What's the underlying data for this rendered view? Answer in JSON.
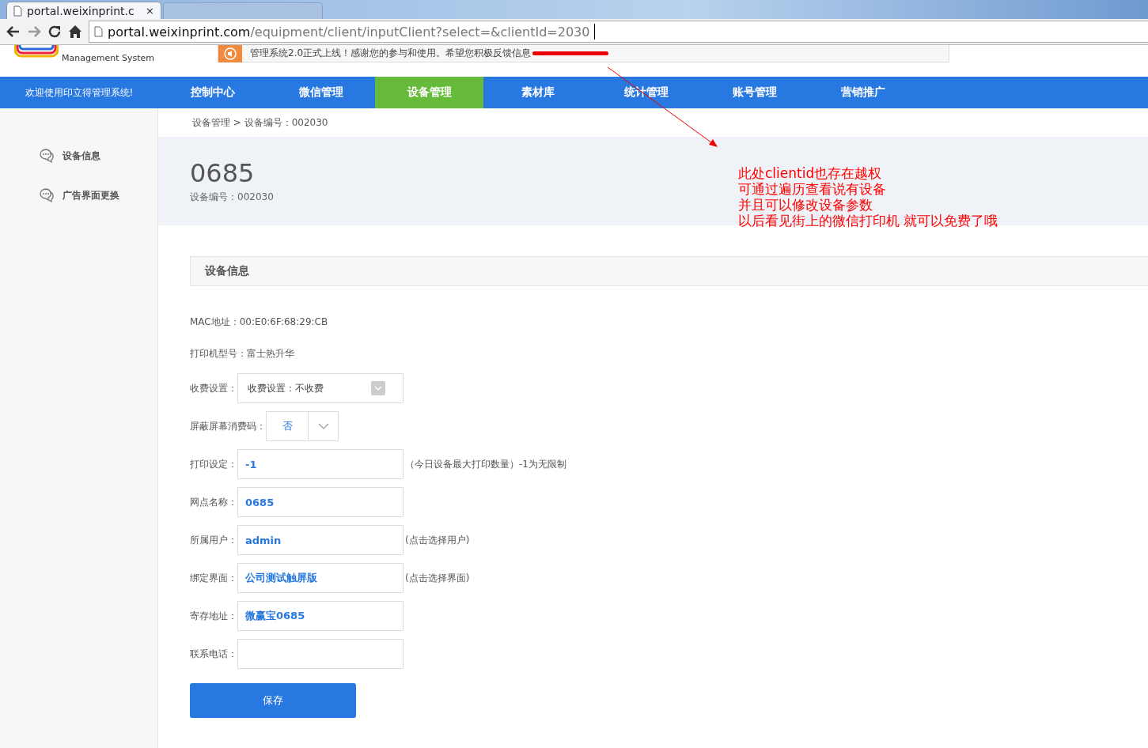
{
  "browser": {
    "tab_title": "portal.weixinprint.c",
    "tab_close": "×",
    "url_host": "portal.weixinprint.com",
    "url_path": "/equipment/client/inputClient?select=&clientId=2030"
  },
  "header": {
    "logo_subtitle": "Management System",
    "notice": "管理系统2.0正式上线！感谢您的参与和使用。希望您积极反馈信息"
  },
  "nav": {
    "welcome": "欢迎使用印立得管理系统!",
    "items": [
      {
        "label": "控制中心",
        "selected": false
      },
      {
        "label": "微信管理",
        "selected": false
      },
      {
        "label": "设备管理",
        "selected": true
      },
      {
        "label": "素材库",
        "selected": false
      },
      {
        "label": "统计管理",
        "selected": false
      },
      {
        "label": "账号管理",
        "selected": false
      },
      {
        "label": "营销推广",
        "selected": false
      }
    ]
  },
  "sidebar": {
    "items": [
      {
        "label": "设备信息"
      },
      {
        "label": "广告界面更换"
      }
    ]
  },
  "breadcrumb": "设备管理 > 设备编号：002030",
  "device": {
    "name": "0685",
    "code": "设备编号：002030"
  },
  "section_title": "设备信息",
  "form": {
    "fields": [
      {
        "kind": "static",
        "label": "MAC地址：",
        "value": "00:E0:6F:68:29:CB"
      },
      {
        "kind": "static",
        "label": "打印机型号：",
        "value": "富士热升华"
      },
      {
        "kind": "select",
        "label": "收费设置：",
        "value": "收费设置：不收费"
      },
      {
        "kind": "dropdown",
        "label": "屏蔽屏幕消费码：",
        "value": "否"
      },
      {
        "kind": "input",
        "label": "打印设定：",
        "value": "-1",
        "hint": "（今日设备最大打印数量）-1为无限制"
      },
      {
        "kind": "input",
        "label": "网点名称：",
        "value": "0685"
      },
      {
        "kind": "input",
        "label": "所属用户：",
        "value": "admin",
        "hint": "(点击选择用户)"
      },
      {
        "kind": "input",
        "label": "绑定界面：",
        "value": "公司测试触屏版",
        "hint": "(点击选择界面)"
      },
      {
        "kind": "input",
        "label": "寄存地址：",
        "value": "微赢宝0685"
      },
      {
        "kind": "input",
        "label": "联系电话："
      }
    ],
    "save": "保存"
  },
  "annotation": {
    "lines": [
      "此处clientid也存在越权",
      "可通过遍历查看说有设备",
      "并且可以修改设备参数",
      "以后看见街上的微信打印机 就可以免费了哦"
    ]
  }
}
